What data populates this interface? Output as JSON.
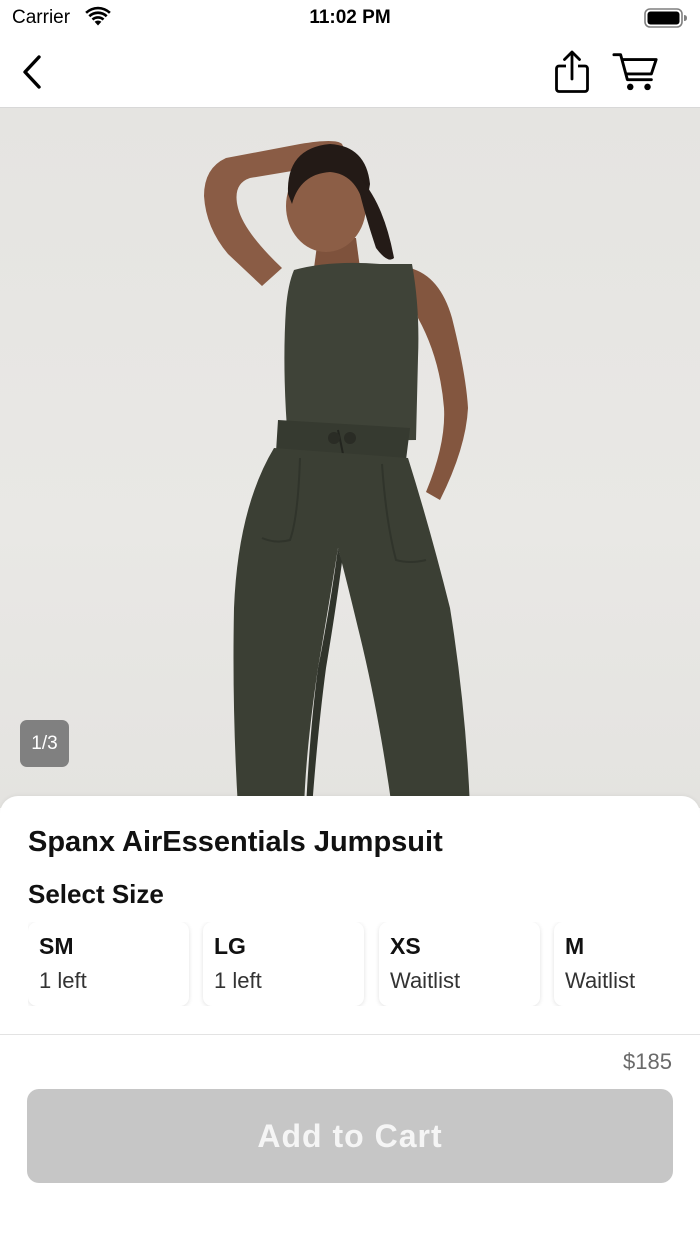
{
  "status_bar": {
    "carrier": "Carrier",
    "time": "11:02 PM"
  },
  "nav": {
    "back_icon": "chevron-left-icon",
    "share_icon": "share-icon",
    "cart_icon": "cart-icon"
  },
  "gallery": {
    "page_indicator": "1/3",
    "current_page": 1,
    "total_pages": 3
  },
  "product": {
    "title": "Spanx AirEssentials Jumpsuit",
    "size_heading": "Select Size",
    "sizes": [
      {
        "name": "SM",
        "status": "1 left"
      },
      {
        "name": "LG",
        "status": "1 left"
      },
      {
        "name": "XS",
        "status": "Waitlist"
      },
      {
        "name": "M",
        "status": "Waitlist"
      }
    ],
    "price": "$185"
  },
  "actions": {
    "add_to_cart_label": "Add to Cart",
    "add_to_cart_enabled": false
  },
  "colors": {
    "button_disabled_bg": "#c6c6c6",
    "button_disabled_text": "#f5f5f5",
    "garment": "#3b3f34",
    "photo_background": "#e7e6e3"
  }
}
